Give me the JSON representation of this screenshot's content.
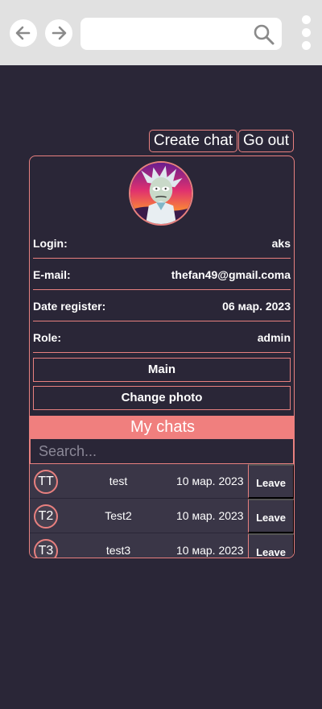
{
  "browser": {
    "back_icon": "arrow-left-icon",
    "forward_icon": "arrow-right-icon",
    "url_value": "",
    "search_icon": "search-icon",
    "menu_icon": "kebab-menu-icon"
  },
  "header": {
    "create_chat_label": "Create chat",
    "go_out_label": "Go out"
  },
  "profile": {
    "avatar_icon": "avatar-image",
    "rows": [
      {
        "label": "Login:",
        "value": "aks"
      },
      {
        "label": "E-mail:",
        "value": "thefan49@gmail.coma"
      },
      {
        "label": "Date register:",
        "value": "06 мар. 2023"
      },
      {
        "label": "Role:",
        "value": "admin"
      }
    ],
    "main_label": "Main",
    "change_photo_label": "Change photo"
  },
  "chats": {
    "title": "My chats",
    "search_placeholder": "Search...",
    "items": [
      {
        "initials": "TT",
        "name": "test",
        "date": "10 мар. 2023",
        "action": "Leave"
      },
      {
        "initials": "T2",
        "name": "Test2",
        "date": "10 мар. 2023",
        "action": "Leave"
      },
      {
        "initials": "T3",
        "name": "test3",
        "date": "10 мар. 2023",
        "action": "Leave"
      }
    ]
  },
  "colors": {
    "background": "#2a2637",
    "accent": "#f07f7e",
    "row": "#3a3647"
  }
}
